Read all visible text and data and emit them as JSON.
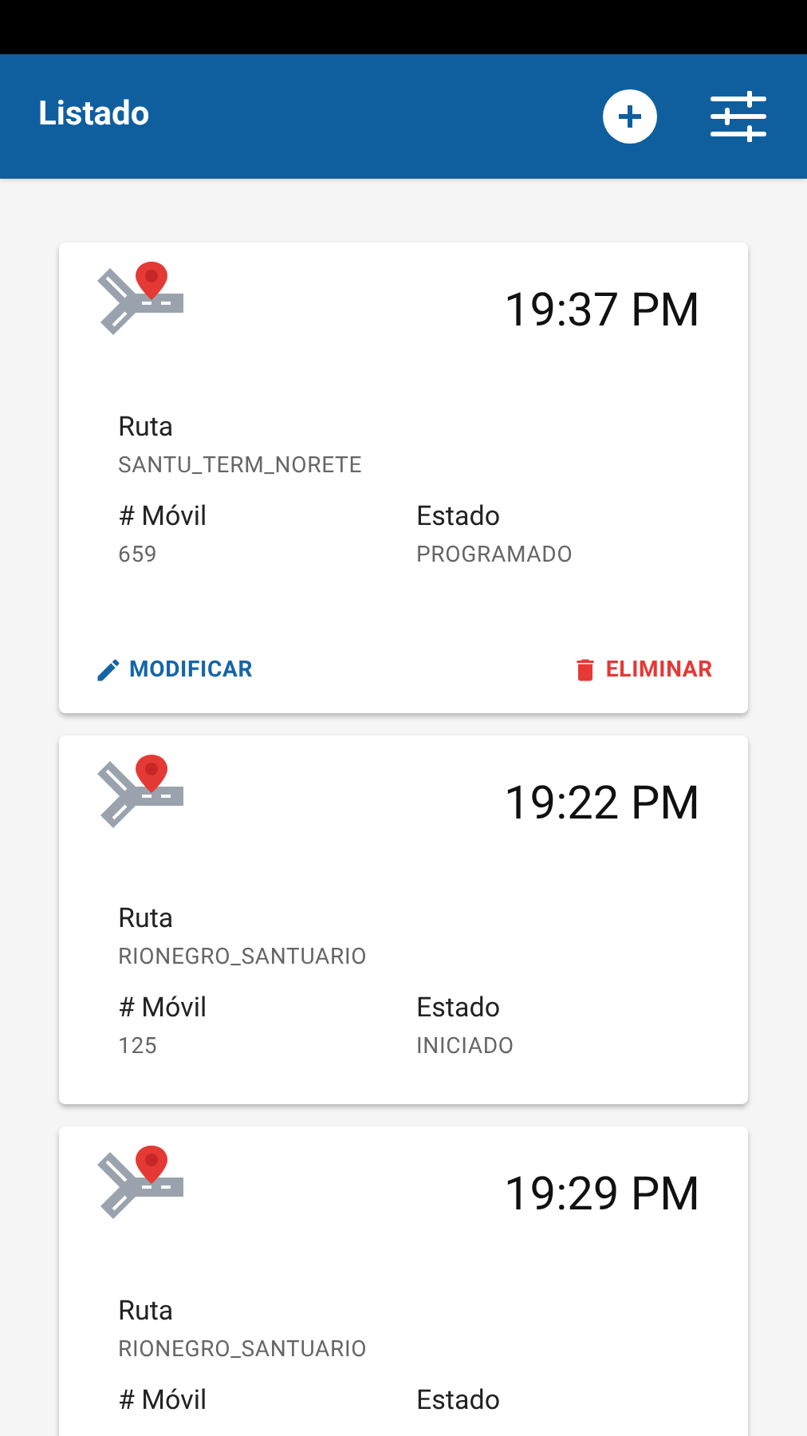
{
  "app_bar": {
    "title": "Listado"
  },
  "cards": [
    {
      "time": "19:37 PM",
      "fields": [
        {
          "label": "Ruta",
          "value": "SANTU_TERM_NORETE"
        },
        {
          "label": "# Móvil",
          "value": "659"
        },
        {
          "label": "Estado",
          "value": "PROGRAMADO"
        }
      ],
      "actions": [
        {
          "kind": "edit",
          "label": "MODIFICAR"
        },
        {
          "kind": "delete",
          "label": "ELIMINAR"
        }
      ]
    },
    {
      "time": "19:22 PM",
      "fields": [
        {
          "label": "Ruta",
          "value": "RIONEGRO_SANTUARIO"
        },
        {
          "label": "# Móvil",
          "value": "125"
        },
        {
          "label": "Estado",
          "value": "INICIADO"
        }
      ]
    },
    {
      "time": "19:29 PM",
      "fields": [
        {
          "label": "Ruta",
          "value": "RIONEGRO_SANTUARIO"
        },
        {
          "label": "# Móvil"
        },
        {
          "label": "Estado"
        }
      ]
    }
  ]
}
